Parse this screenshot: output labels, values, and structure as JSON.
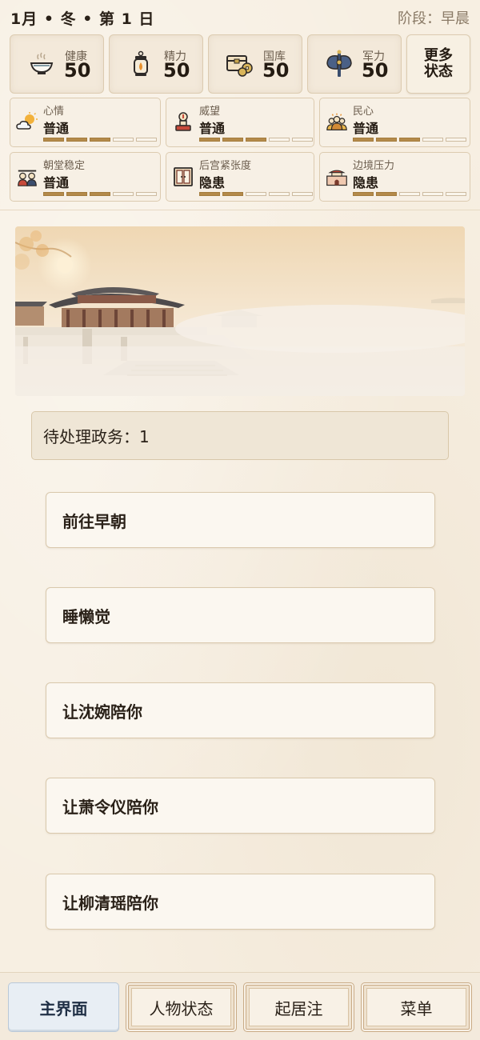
{
  "header": {
    "date": "1月 • 冬 • 第 1 日",
    "phase": "阶段：早晨"
  },
  "main_stats": [
    {
      "label": "健康",
      "value": "50",
      "icon": "bowl-icon"
    },
    {
      "label": "精力",
      "value": "50",
      "icon": "lantern-icon"
    },
    {
      "label": "国库",
      "value": "50",
      "icon": "treasury-chest-icon"
    },
    {
      "label": "军力",
      "value": "50",
      "icon": "battle-axe-icon"
    }
  ],
  "more_status": "更多\n状态",
  "sub_stats": [
    {
      "label": "心情",
      "value": "普通",
      "icon": "sun-cloud-icon",
      "level": 3,
      "max": 5
    },
    {
      "label": "威望",
      "value": "普通",
      "icon": "seal-stamp-icon",
      "level": 3,
      "max": 5
    },
    {
      "label": "民心",
      "value": "普通",
      "icon": "crowd-icon",
      "level": 3,
      "max": 5
    },
    {
      "label": "朝堂稳定",
      "value": "普通",
      "icon": "court-officials-icon",
      "level": 3,
      "max": 5
    },
    {
      "label": "后宫紧张度",
      "value": "隐患",
      "icon": "palace-door-icon",
      "level": 2,
      "max": 5
    },
    {
      "label": "边境压力",
      "value": "隐患",
      "icon": "fortress-gate-icon",
      "level": 2,
      "max": 5
    }
  ],
  "pending": "待处理政务：1",
  "actions": [
    "前往早朝",
    "睡懒觉",
    "让沈婉陪你",
    "让萧令仪陪你",
    "让柳清瑶陪你"
  ],
  "tabs": [
    {
      "label": "主界面",
      "active": true
    },
    {
      "label": "人物状态",
      "active": false
    },
    {
      "label": "起居注",
      "active": false
    },
    {
      "label": "菜单",
      "active": false
    }
  ],
  "colors": {
    "background": "#f7efe2",
    "bar_fill": "#b48a4a",
    "active_tab": "#e8eef4"
  }
}
